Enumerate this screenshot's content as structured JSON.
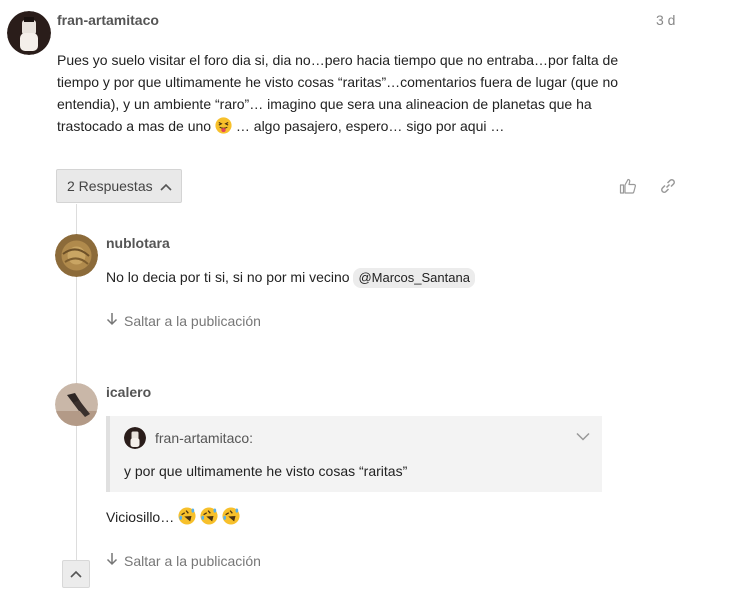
{
  "post": {
    "username": "fran-artamitaco",
    "date": "3 d",
    "body_line1": "Pues yo suelo visitar el foro dia si, dia no…pero hacia tiempo que no entraba…por falta de",
    "body_line2": "tiempo y por que ultimamente he visto cosas “raritas”…comentarios fuera de lugar (que no",
    "body_line3": "entendia), y un ambiente “raro”… imagino que sera una alineacion de planetas que ha",
    "body_line4_before": "trastocado a mas de uno",
    "body_line4_after": " … algo pasajero, espero… sigo por aqui …",
    "replies_label": "2 Respuestas",
    "icons": {
      "like": "like-icon",
      "link": "link-icon",
      "emoji": "squinting-tongue-emoji"
    }
  },
  "replies": [
    {
      "username": "nublotara",
      "body": "No lo decia por ti si, si no por mi vecino",
      "mention": "@Marcos_Santana",
      "jump_label": "Saltar a la publicación"
    },
    {
      "username": "icalero",
      "quote_user": "fran-artamitaco:",
      "quote_text": "y por que ultimamente he visto cosas “raritas”",
      "body": "Viciosillo…",
      "emoji": "rolling-on-floor-laughing-emoji",
      "jump_label": "Saltar a la publicación"
    }
  ],
  "colors": {
    "username": "#555555",
    "muted": "#777777",
    "accent_gray": "#e9e9e9"
  }
}
